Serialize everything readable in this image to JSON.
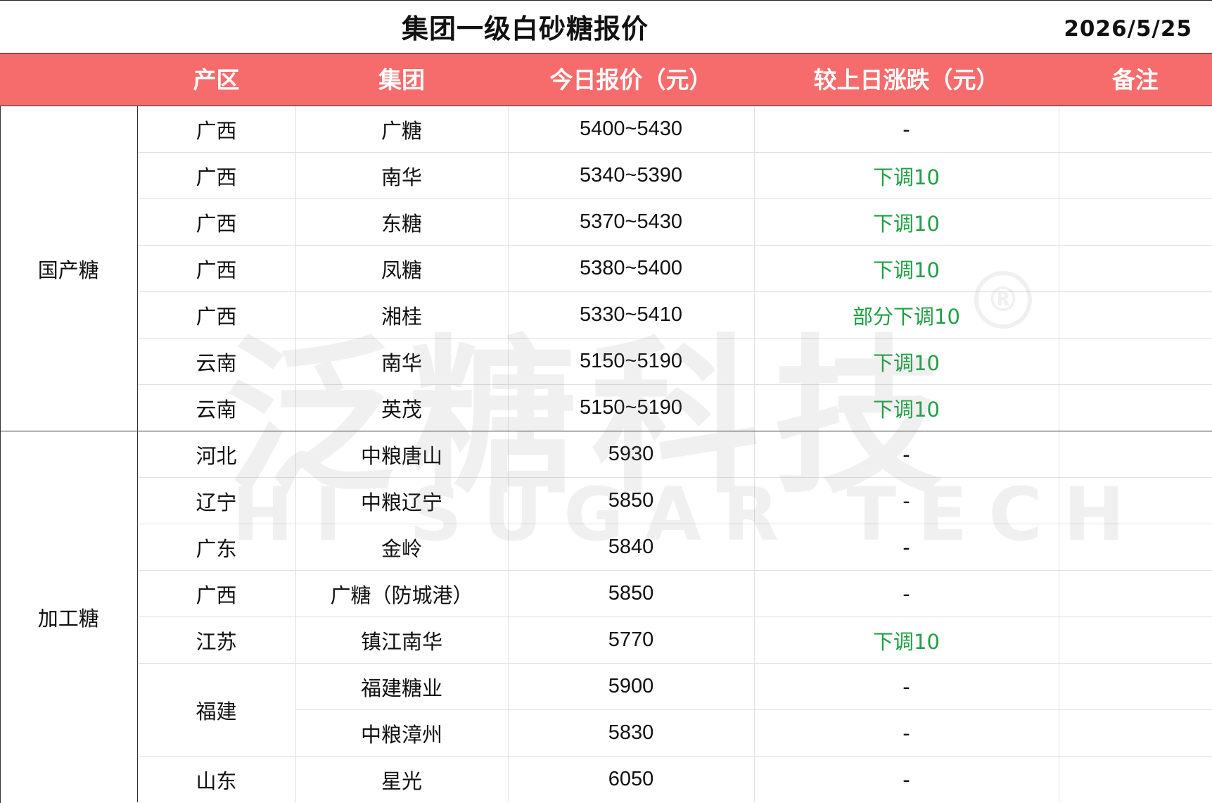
{
  "title": "集团一级白砂糖报价",
  "date": "2026/5/25",
  "columns": [
    "产区",
    "集团",
    "今日报价（元）",
    "较上日涨跌（元）",
    "备注"
  ],
  "categories": {
    "domestic": "国产糖",
    "processed": "加工糖"
  },
  "rows": [
    {
      "region": "广西",
      "group": "广糖",
      "price": "5400~5430",
      "change": "-",
      "note": ""
    },
    {
      "region": "广西",
      "group": "南华",
      "price": "5340~5390",
      "change": "下调10",
      "note": ""
    },
    {
      "region": "广西",
      "group": "东糖",
      "price": "5370~5430",
      "change": "下调10",
      "note": ""
    },
    {
      "region": "广西",
      "group": "凤糖",
      "price": "5380~5400",
      "change": "下调10",
      "note": ""
    },
    {
      "region": "广西",
      "group": "湘桂",
      "price": "5330~5410",
      "change": "部分下调10",
      "note": ""
    },
    {
      "region": "云南",
      "group": "南华",
      "price": "5150~5190",
      "change": "下调10",
      "note": ""
    },
    {
      "region": "云南",
      "group": "英茂",
      "price": "5150~5190",
      "change": "下调10",
      "note": ""
    },
    {
      "region": "河北",
      "group": "中粮唐山",
      "price": "5930",
      "change": "-",
      "note": ""
    },
    {
      "region": "辽宁",
      "group": "中粮辽宁",
      "price": "5850",
      "change": "-",
      "note": ""
    },
    {
      "region": "广东",
      "group": "金岭",
      "price": "5840",
      "change": "-",
      "note": ""
    },
    {
      "region": "广西",
      "group": "广糖（防城港）",
      "price": "5850",
      "change": "-",
      "note": ""
    },
    {
      "region": "江苏",
      "group": "镇江南华",
      "price": "5770",
      "change": "下调10",
      "note": ""
    },
    {
      "region": "福建",
      "group": "福建糖业",
      "price": "5900",
      "change": "-",
      "note": ""
    },
    {
      "region": "",
      "group": "中粮漳州",
      "price": "5830",
      "change": "-",
      "note": ""
    },
    {
      "region": "山东",
      "group": "星光",
      "price": "6050",
      "change": "-",
      "note": ""
    }
  ],
  "watermark": {
    "cn": "泛糖科技",
    "en": "HI SUGAR TECH",
    "reg": "®"
  },
  "colors": {
    "header_bg": "#f66b6b",
    "down": "#1fa043"
  }
}
